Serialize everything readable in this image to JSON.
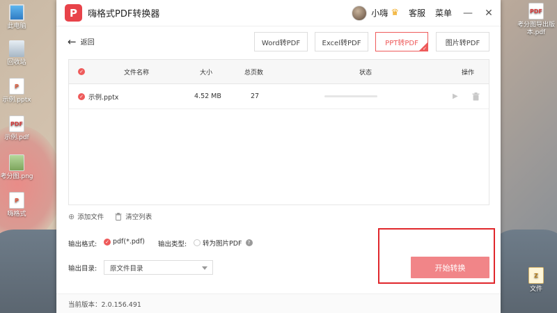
{
  "desktop": {
    "icons_left": [
      {
        "label": "此电脑",
        "glyph": "",
        "kind": "pc"
      },
      {
        "label": "回收站",
        "glyph": "",
        "kind": "bin"
      },
      {
        "label": "示例.pptx",
        "glyph": "P",
        "kind": "ppt"
      },
      {
        "label": "示例.pdf",
        "glyph": "PDF",
        "kind": "pdf"
      },
      {
        "label": "考分图.png",
        "glyph": "",
        "kind": "png"
      },
      {
        "label": "嗨格式",
        "glyph": "P",
        "kind": "app"
      }
    ],
    "icon_right_top": {
      "label": "考分图导出版本.pdf",
      "glyph": "PDF"
    },
    "icon_right_bottom": {
      "label": "文件",
      "glyph": "Z"
    }
  },
  "app": {
    "title": "嗨格式PDF转换器",
    "logo_glyph": "P",
    "user": {
      "name": "小嗨",
      "crown": "♛"
    },
    "links": {
      "service": "客服",
      "menu": "菜单"
    },
    "window_controls": {
      "minimize": "—",
      "close": "✕"
    },
    "back_label": "返回",
    "tabs": [
      {
        "label": "Word转PDF",
        "active": false
      },
      {
        "label": "Excel转PDF",
        "active": false
      },
      {
        "label": "PPT转PDF",
        "active": true
      },
      {
        "label": "图片转PDF",
        "active": false
      }
    ],
    "table": {
      "headers": {
        "name": "文件名称",
        "size": "大小",
        "pages": "总页数",
        "status": "状态",
        "action": "操作"
      },
      "rows": [
        {
          "name": "示例.pptx",
          "size": "4.52 MB",
          "pages": "27",
          "progress": 0
        }
      ]
    },
    "file_actions": {
      "add": "添加文件",
      "clear": "清空列表"
    },
    "output_format": {
      "label": "输出格式:",
      "value": "pdf(*.pdf)"
    },
    "output_type": {
      "label": "输出类型:",
      "option": "转为图片PDF",
      "checked": false
    },
    "output_dir": {
      "label": "输出目录:",
      "value": "原文件目录"
    },
    "start_button": "开始转换",
    "version": "当前版本：2.0.156.491"
  },
  "colors": {
    "accent": "#ee5a5a",
    "start_button": "#f18588",
    "highlight": "#e0262b"
  }
}
